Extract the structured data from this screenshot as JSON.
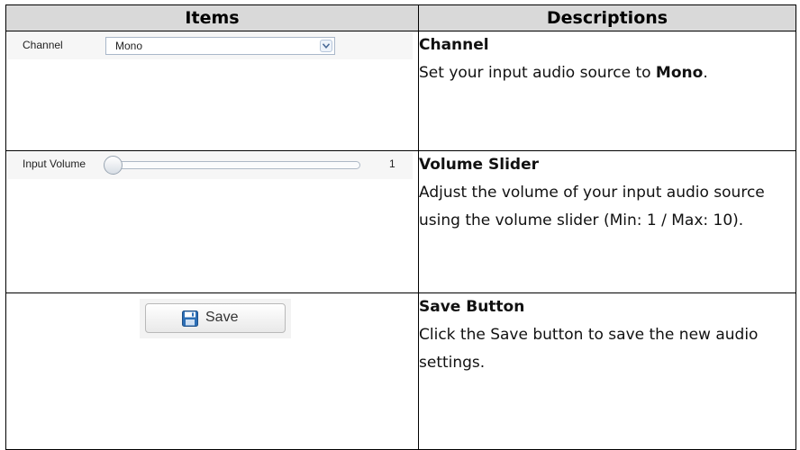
{
  "table": {
    "headers": {
      "items": "Items",
      "descriptions": "Descriptions"
    },
    "rows": [
      {
        "item": {
          "label": "Channel",
          "value": "Mono",
          "control": "select",
          "icon": "chevron-down-icon"
        },
        "title": "Channel",
        "desc_prefix": "Set your input audio source to ",
        "desc_bold": "Mono",
        "desc_suffix": "."
      },
      {
        "item": {
          "label": "Input Volume",
          "value": "1",
          "control": "slider"
        },
        "title": "Volume Slider",
        "desc": "Adjust the volume of your input audio source using the volume slider (Min: 1 / Max: 10)."
      },
      {
        "item": {
          "label": "Save",
          "control": "button",
          "icon": "floppy-disk-icon"
        },
        "title": "Save Button",
        "desc": "Click the Save button to save the new audio settings."
      }
    ]
  },
  "colors": {
    "header_bg": "#d9d9d9",
    "border": "#000000",
    "save_icon": "#2d6fb6"
  }
}
